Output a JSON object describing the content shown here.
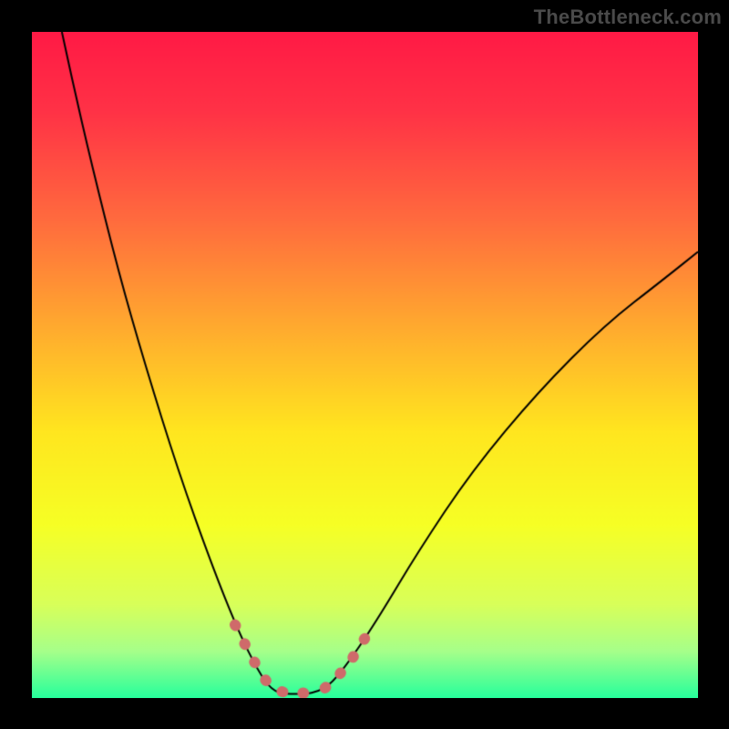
{
  "watermark": {
    "text": "TheBottleneck.com"
  },
  "chart_data": {
    "type": "line",
    "title": "",
    "xlabel": "",
    "ylabel": "",
    "xlim": [
      0,
      100
    ],
    "ylim": [
      0,
      100
    ],
    "background_gradient": {
      "stops": [
        {
          "pos": 0.0,
          "color": "#ff1a45"
        },
        {
          "pos": 0.12,
          "color": "#ff3246"
        },
        {
          "pos": 0.28,
          "color": "#ff6a3e"
        },
        {
          "pos": 0.45,
          "color": "#ffad2e"
        },
        {
          "pos": 0.6,
          "color": "#ffe61f"
        },
        {
          "pos": 0.74,
          "color": "#f6ff25"
        },
        {
          "pos": 0.86,
          "color": "#d8ff5a"
        },
        {
          "pos": 0.93,
          "color": "#a6ff8a"
        },
        {
          "pos": 1.0,
          "color": "#26ff9c"
        }
      ]
    },
    "series": [
      {
        "name": "bottleneck-curve",
        "type": "line",
        "color": "#000000",
        "width": 2,
        "points": [
          {
            "x": 4.5,
            "y": 100
          },
          {
            "x": 6,
            "y": 93
          },
          {
            "x": 9,
            "y": 80
          },
          {
            "x": 13,
            "y": 64
          },
          {
            "x": 17,
            "y": 50
          },
          {
            "x": 22,
            "y": 34
          },
          {
            "x": 27,
            "y": 20
          },
          {
            "x": 31,
            "y": 10
          },
          {
            "x": 34,
            "y": 4
          },
          {
            "x": 36,
            "y": 1.2
          },
          {
            "x": 38,
            "y": 0.6
          },
          {
            "x": 41,
            "y": 0.6
          },
          {
            "x": 43,
            "y": 1.0
          },
          {
            "x": 45,
            "y": 2.2
          },
          {
            "x": 48,
            "y": 6
          },
          {
            "x": 52,
            "y": 12
          },
          {
            "x": 58,
            "y": 22
          },
          {
            "x": 66,
            "y": 34
          },
          {
            "x": 76,
            "y": 46
          },
          {
            "x": 86,
            "y": 56
          },
          {
            "x": 95,
            "y": 63
          },
          {
            "x": 100,
            "y": 67
          }
        ]
      },
      {
        "name": "highlight-left",
        "type": "line",
        "color": "#cf6a6a",
        "width": 12,
        "cap": "round",
        "dash": [
          1,
          22
        ],
        "points": [
          {
            "x": 30.5,
            "y": 11
          },
          {
            "x": 32.5,
            "y": 7
          },
          {
            "x": 34.5,
            "y": 3.5
          },
          {
            "x": 36.0,
            "y": 1.4
          },
          {
            "x": 38.0,
            "y": 0.8
          },
          {
            "x": 40.0,
            "y": 0.7
          },
          {
            "x": 42.0,
            "y": 0.8
          }
        ]
      },
      {
        "name": "highlight-right",
        "type": "line",
        "color": "#cf6a6a",
        "width": 12,
        "cap": "round",
        "dash": [
          1,
          22
        ],
        "points": [
          {
            "x": 44.0,
            "y": 1.5
          },
          {
            "x": 45.5,
            "y": 2.8
          },
          {
            "x": 47.0,
            "y": 4.5
          },
          {
            "x": 48.5,
            "y": 6.5
          },
          {
            "x": 50.0,
            "y": 9.0
          }
        ]
      }
    ]
  }
}
